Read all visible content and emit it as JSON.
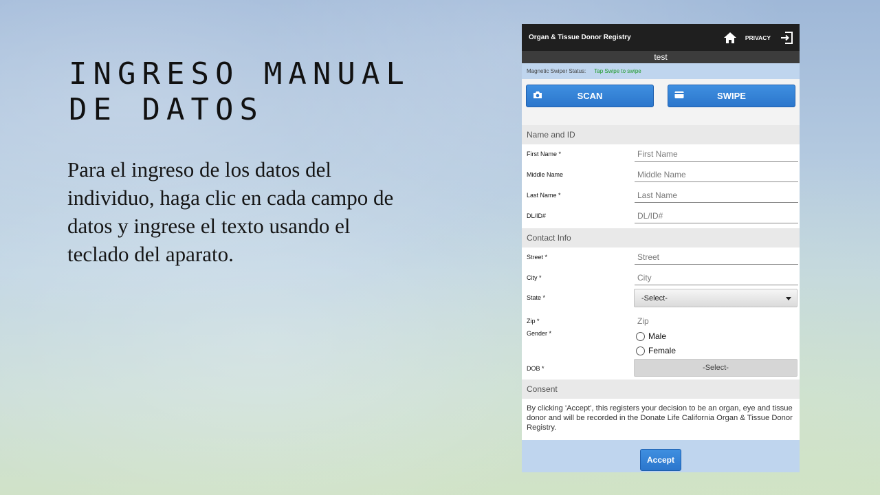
{
  "slide": {
    "title": "INGRESO MANUAL DE DATOS",
    "body": "Para el ingreso de los datos del individuo, haga clic en cada campo de datos y ingrese el texto usando el teclado del aparato."
  },
  "app": {
    "header": {
      "title": "Organ & Tissue Donor Registry",
      "privacy_label": "PRIVACY",
      "home_icon": "home-icon",
      "exit_icon": "exit-icon"
    },
    "banner": "test",
    "swiper": {
      "label": "Magnetic Swiper Status:",
      "value": "Tap Swipe to swipe",
      "value_color": "#1f9a2a"
    },
    "buttons": {
      "scan_label": "SCAN",
      "scan_icon": "camera-icon",
      "swipe_label": "SWIPE",
      "swipe_icon": "card-icon",
      "accent": "#2b76cc"
    },
    "name_section": {
      "title": "Name and ID",
      "fields": [
        {
          "label": "First Name *",
          "placeholder": "First Name"
        },
        {
          "label": "Middle Name",
          "placeholder": "Middle Name"
        },
        {
          "label": "Last Name *",
          "placeholder": "Last Name"
        },
        {
          "label": "DL/ID#",
          "placeholder": "DL/ID#"
        }
      ]
    },
    "contact_section": {
      "title": "Contact Info",
      "street": {
        "label": "Street *",
        "placeholder": "Street"
      },
      "city": {
        "label": "City *",
        "placeholder": "City"
      },
      "state": {
        "label": "State *",
        "selected": "-Select-"
      },
      "zip": {
        "label": "Zip *",
        "placeholder": "Zip"
      },
      "gender": {
        "label": "Gender *",
        "options": [
          "Male",
          "Female"
        ]
      },
      "dob": {
        "label": "DOB *",
        "selected": "-Select-"
      }
    },
    "consent_section": {
      "title": "Consent",
      "text": "By clicking 'Accept', this registers your decision to be an organ, eye and tissue donor and will be recorded in the Donate Life California Organ & Tissue Donor Registry.",
      "accept_label": "Accept"
    }
  }
}
